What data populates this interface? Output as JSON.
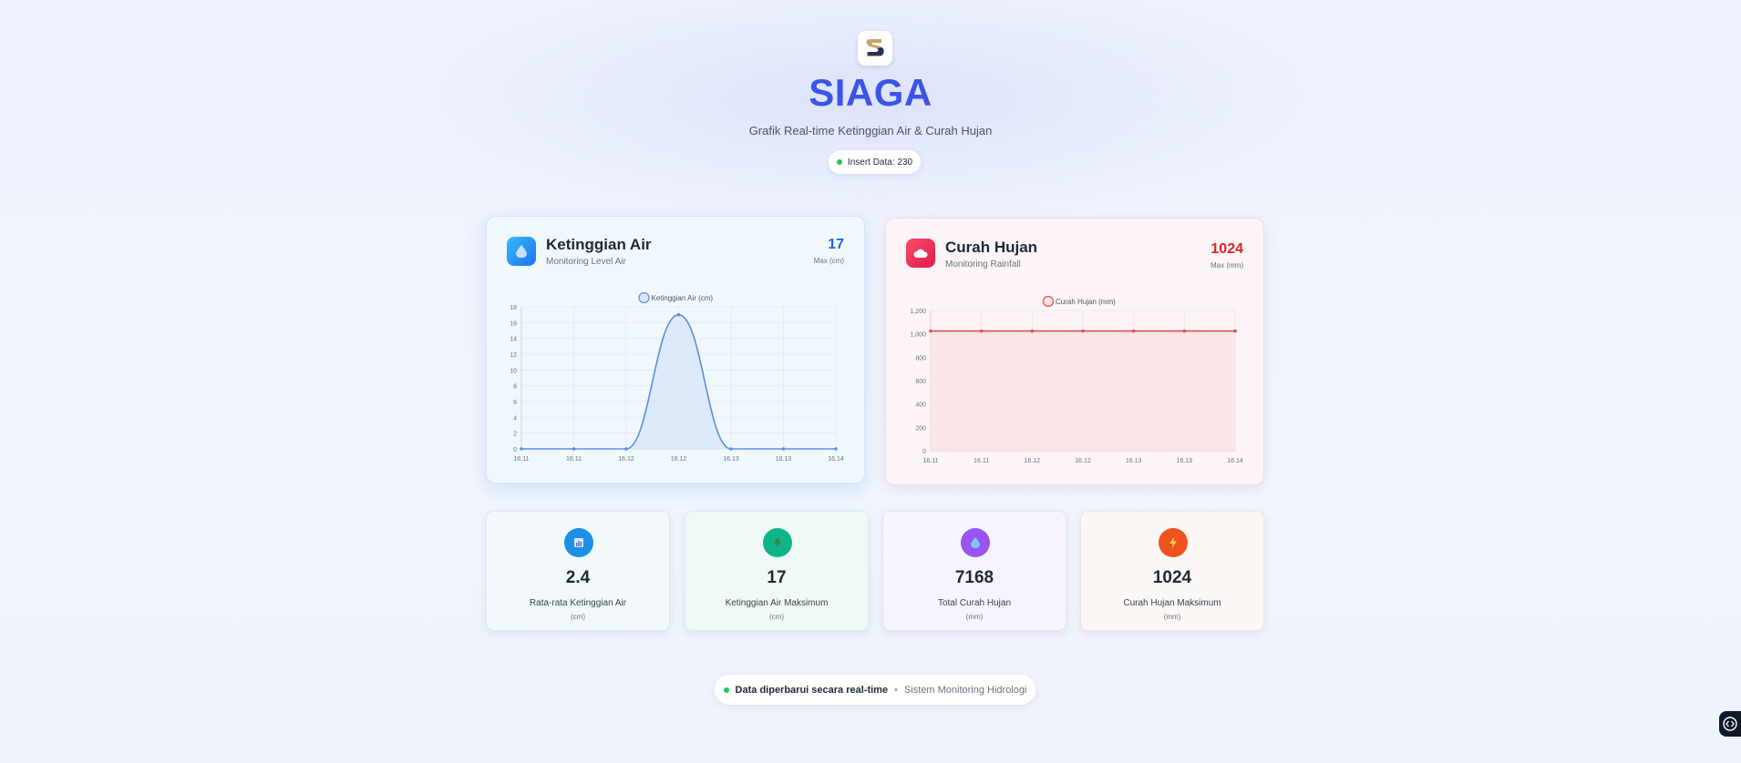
{
  "header": {
    "title": "SIAGA",
    "subtitle": "Grafik Real-time Ketinggian Air & Curah Hujan",
    "insert_badge": "Insert Data: 230"
  },
  "water_card": {
    "title": "Ketinggian Air",
    "subtitle": "Monitoring Level Air",
    "max_value": "17",
    "max_label": "Max (cm)",
    "icon": "water-drop-icon",
    "accent": "#1e63e9"
  },
  "rain_card": {
    "title": "Curah Hujan",
    "subtitle": "Monitoring Rainfall",
    "max_value": "1024",
    "max_label": "Max (mm)",
    "icon": "cloud-icon",
    "accent": "#dc2626"
  },
  "chart_data": [
    {
      "type": "line",
      "legend": "Ketinggian Air (cm)",
      "x": [
        "16.11",
        "16.11",
        "16.12",
        "16.12",
        "16.13",
        "16.13",
        "16.14"
      ],
      "y_ticks": [
        "0",
        "2",
        "4",
        "6",
        "8",
        "10",
        "12",
        "14",
        "16",
        "18"
      ],
      "ylim": [
        0,
        18
      ],
      "series": [
        {
          "name": "Ketinggian Air (cm)",
          "values": [
            0,
            0,
            0,
            17,
            0,
            0,
            0
          ]
        }
      ],
      "color": "#5b8fe0",
      "fill": "#dbe7f8",
      "smooth": true,
      "grid": true,
      "legend_position": "top"
    },
    {
      "type": "area",
      "legend": "Curah Hujan (mm)",
      "x": [
        "16.11",
        "16.11",
        "16.12",
        "16.12",
        "16.13",
        "16.13",
        "16.14"
      ],
      "y_ticks": [
        "0",
        "200",
        "400",
        "600",
        "800",
        "1,000",
        "1,200"
      ],
      "ylim": [
        0,
        1200
      ],
      "series": [
        {
          "name": "Curah Hujan (mm)",
          "values": [
            1024,
            1024,
            1024,
            1024,
            1024,
            1024,
            1024
          ]
        }
      ],
      "color": "#e05252",
      "fill": "#fbe2e3",
      "grid": true,
      "legend_position": "top"
    }
  ],
  "stats": [
    {
      "value": "2.4",
      "label": "Rata-rata Ketinggian Air",
      "unit": "(cm)",
      "icon": "bar-chart-icon",
      "color": "#1d8fe6",
      "bg": "#f2f8fb"
    },
    {
      "value": "17",
      "label": "Ketinggian Air Maksimum",
      "unit": "(cm)",
      "icon": "tree-icon",
      "color": "#10b489",
      "bg": "#effaf7"
    },
    {
      "value": "7168",
      "label": "Total Curah Hujan",
      "unit": "(mm)",
      "icon": "water-drop-icon",
      "color": "#9a55ef",
      "bg": "#f6f5fd"
    },
    {
      "value": "1024",
      "label": "Curah Hujan Maksimum",
      "unit": "(mm)",
      "icon": "lightning-icon",
      "color": "#f0521d",
      "bg": "#fcf6f5"
    }
  ],
  "footer": {
    "realtime": "Data diperbarui secara real-time",
    "separator": "•",
    "system": "Sistem Monitoring Hidrologi"
  }
}
